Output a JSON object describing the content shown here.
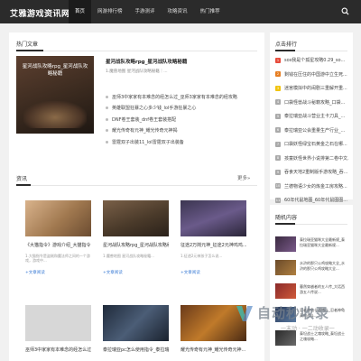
{
  "header": {
    "logo": "艾雅游戏资讯网",
    "nav": [
      "首页",
      "网游排行榜",
      "手游测评",
      "攻略资讯",
      "热门推荐"
    ],
    "active_index": 0
  },
  "hot": {
    "title": "热门文章",
    "image_caption": "星河战队攻略rpg_星河战队攻略秘籍",
    "lead_title": "星河战队攻略rpg_星河战队攻略秘籍",
    "lead_desc": "1.魔兽地图 星河战队攻略秘籍｜...",
    "list": [
      "巫师3中家家有本难念的经怎么过_巫师3家家有本难念的经攻略",
      "英雄联盟狂暴之心多少钱_lol手游狂暴之心",
      "DNF卷王套装_dnf卷王套装搭配",
      "耀光传奇有元神_耀光传奇元神揭",
      "雷霆双子出装11_lol雷霆双子出装备"
    ]
  },
  "recommend": {
    "title": "点击排行",
    "items": [
      "sos我是个孤星攻略0.29_so...",
      "剩钱在压住的中国游中立生死...",
      "迷宫模拟中的闹剧三重解开重...",
      "口袋怪兽战斗秘籍攻略_口袋...",
      "泰拉瑞亚战斗营业主卡刀具_...",
      "泰拉瑞亚公会重量生产行业_...",
      "口袋妖怪绿宝石黄金之石在哪...",
      "孩童妖怪世界小说排第二卷中文...",
      "吞食天地2重制版手游攻略_吞...",
      "兰德物语少女的炼金工房攻略...",
      "60年代鼠地图_60年代鼠图图..."
    ],
    "number_colors": [
      "#e74c3c",
      "#e67e22",
      "#f1c40f",
      "#aaaaaa",
      "#aaaaaa",
      "#aaaaaa",
      "#aaaaaa",
      "#aaaaaa",
      "#aaaaaa",
      "#aaaaaa",
      "#aaaaaa"
    ]
  },
  "news": {
    "title": "资讯",
    "more": "更多»",
    "cards": [
      {
        "title": "《大猫指令》游戏介绍_大猫指令...",
        "desc": "1.大猫指令是盗贼和魔法师之间的一个游戏，游戏中...",
        "tag": "+文章阅读"
      },
      {
        "title": "星河战队攻略rpg_星河战队攻略秘籍",
        "desc": "1.魔兽地图 星河战队攻略秘籍...",
        "tag": "+文章阅读"
      },
      {
        "title": "征途2万岗元神_征途2元神鸡鸡...",
        "desc": "1.征途2元神孩子怎么说...",
        "tag": "+文章阅读"
      },
      {
        "title": "巫师3中家家有本难念的经怎么过_巫...",
        "desc": "",
        "tag": ""
      },
      {
        "title": "泰拉瑞亚pc怎么使用指令_泰拉瑞...",
        "desc": "",
        "tag": ""
      },
      {
        "title": "耀光传奇有元神_耀光传奇元神...",
        "desc": "",
        "tag": ""
      }
    ]
  },
  "random": {
    "title": "随机内容",
    "items": [
      "泰拉瑞亚猫咪大全最新规_泰拉瑞亚猫咪大全最新规...",
      "水浒的那只公鸡攻略大全_水浒的那只公鸡攻略大全...",
      "暮然穿越者的五人传_大话西游五人传说...",
      "忍者神龟卡通搏斗_忍者神龟真的战斗...",
      "泰坦战士之魂攻略_泰坦战士之魂攻略..."
    ]
  },
  "watermark": {
    "text": "自动秒收录",
    "sub": "一末动 · 一二动收录一"
  }
}
